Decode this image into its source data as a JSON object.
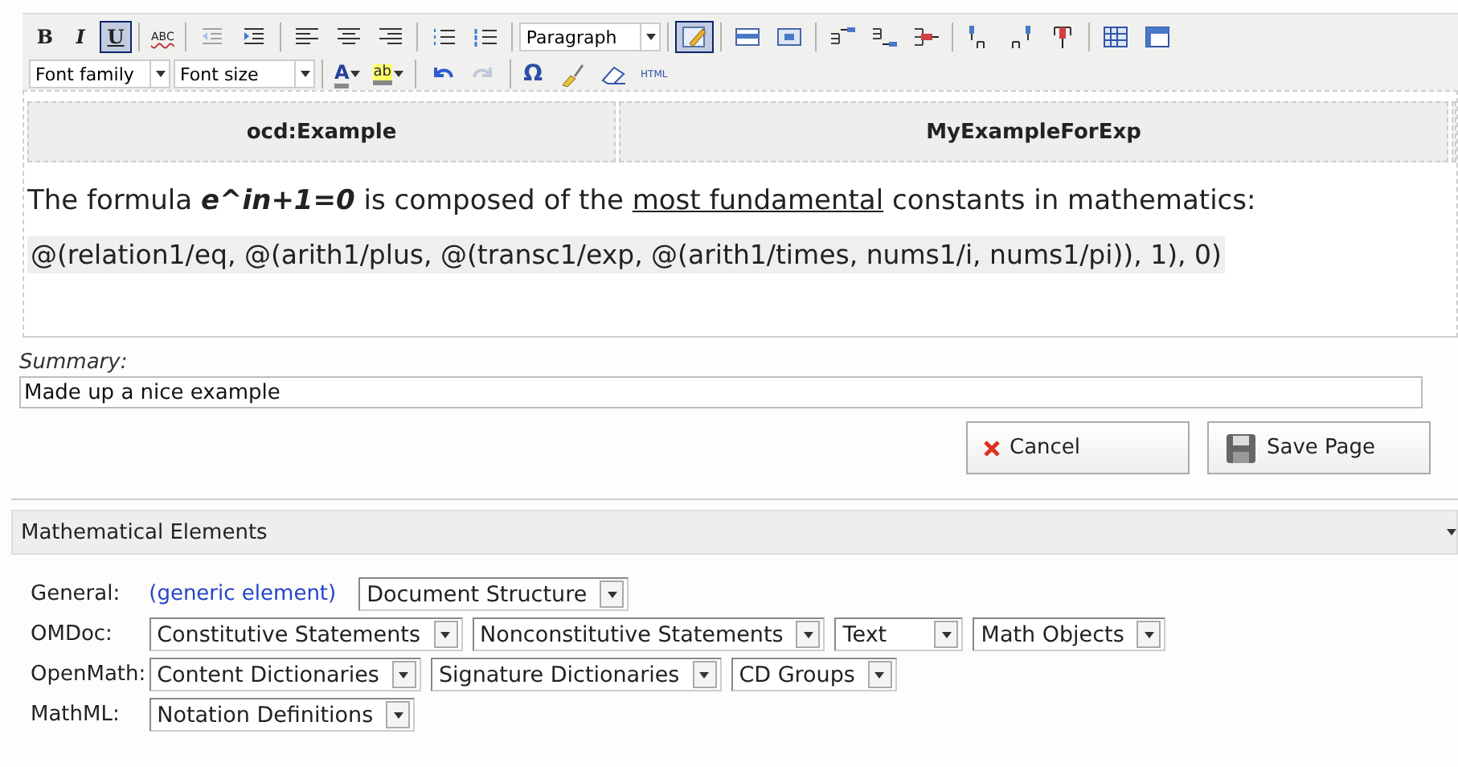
{
  "toolbar": {
    "row1": [
      {
        "kind": "text",
        "label": "B",
        "selected": false
      },
      {
        "kind": "text",
        "label": "I",
        "selected": false
      },
      {
        "kind": "text",
        "label": "U",
        "selected": true
      },
      {
        "kind": "separator"
      },
      {
        "kind": "text",
        "label": "ABC",
        "selected": false
      },
      {
        "kind": "separator"
      },
      {
        "kind": "icon",
        "selected": false,
        "disabled": true
      },
      {
        "kind": "icon",
        "selected": false,
        "disabled": false
      },
      {
        "kind": "separator"
      },
      {
        "kind": "icon",
        "selected": false,
        "disabled": false
      },
      {
        "kind": "icon",
        "selected": false,
        "disabled": false
      },
      {
        "kind": "icon",
        "selected": false,
        "disabled": false
      },
      {
        "kind": "separator"
      },
      {
        "kind": "icon",
        "selected": false,
        "disabled": false
      },
      {
        "kind": "icon",
        "selected": false,
        "disabled": false
      },
      {
        "kind": "separator"
      },
      {
        "kind": "select",
        "value": "Paragraph"
      },
      {
        "kind": "separator"
      },
      {
        "kind": "icon",
        "selected": true,
        "disabled": false
      },
      {
        "kind": "separator"
      },
      {
        "kind": "icon",
        "selected": false,
        "disabled": false
      },
      {
        "kind": "icon",
        "selected": false,
        "disabled": false
      },
      {
        "kind": "separator"
      },
      {
        "kind": "icon",
        "selected": false,
        "disabled": false
      },
      {
        "kind": "icon",
        "selected": false,
        "disabled": false
      },
      {
        "kind": "icon",
        "selected": false,
        "disabled": false
      },
      {
        "kind": "separator"
      },
      {
        "kind": "icon",
        "selected": false,
        "disabled": false
      },
      {
        "kind": "icon",
        "selected": false,
        "disabled": false
      },
      {
        "kind": "icon",
        "selected": false,
        "disabled": false
      },
      {
        "kind": "separator"
      },
      {
        "kind": "icon",
        "selected": false,
        "disabled": false
      },
      {
        "kind": "icon",
        "selected": false,
        "disabled": false
      }
    ],
    "row2": [
      {
        "kind": "select",
        "value": "Font family"
      },
      {
        "kind": "select",
        "value": "Font size"
      },
      {
        "kind": "separator"
      },
      {
        "kind": "text",
        "label": "A",
        "selected": false
      },
      {
        "kind": "text",
        "label": "ab",
        "selected": false
      },
      {
        "kind": "separator"
      },
      {
        "kind": "icon",
        "selected": false,
        "disabled": false
      },
      {
        "kind": "icon",
        "selected": false,
        "disabled": true
      },
      {
        "kind": "separator"
      },
      {
        "kind": "text",
        "label": "Ω",
        "selected": false
      },
      {
        "kind": "icon",
        "selected": false,
        "disabled": false
      },
      {
        "kind": "icon",
        "selected": false,
        "disabled": false
      },
      {
        "kind": "text",
        "label": "HTML",
        "selected": false
      }
    ]
  },
  "editor": {
    "table_headers": [
      "ocd:Example",
      "MyExampleForExp"
    ],
    "paragraph": [
      {
        "kind": "plain",
        "text": "The formula "
      },
      {
        "kind": "formula",
        "text": "e^in+1=0"
      },
      {
        "kind": "plain",
        "text": " is composed of the "
      },
      {
        "kind": "underline",
        "text": "most fundamental"
      },
      {
        "kind": "plain",
        "text": " constants in mathematics:"
      }
    ],
    "formula_line": "@(relation1/eq, @(arith1/plus, @(transc1/exp, @(arith1/times, nums1/i, nums1/pi)), 1), 0)"
  },
  "summary": {
    "label": "Summary:",
    "value": "Made up a nice example"
  },
  "buttons": [
    {
      "kind": "cancel",
      "label": "Cancel"
    },
    {
      "kind": "save",
      "label": "Save Page"
    }
  ],
  "panel": {
    "title": "Mathematical Elements",
    "rows": [
      {
        "label": "General:",
        "items": [
          {
            "kind": "link",
            "text": "(generic element)"
          },
          {
            "kind": "select",
            "text": "Document Structure"
          }
        ]
      },
      {
        "label": "OMDoc:",
        "items": [
          {
            "kind": "select",
            "text": "Constitutive Statements"
          },
          {
            "kind": "select",
            "text": "Nonconstitutive Statements"
          },
          {
            "kind": "select",
            "text": "Text"
          },
          {
            "kind": "select",
            "text": "Math Objects"
          }
        ]
      },
      {
        "label": "OpenMath:",
        "items": [
          {
            "kind": "select",
            "text": "Content Dictionaries"
          },
          {
            "kind": "select",
            "text": "Signature Dictionaries"
          },
          {
            "kind": "select",
            "text": "CD Groups"
          }
        ]
      },
      {
        "label": "MathML:",
        "items": [
          {
            "kind": "select",
            "text": "Notation Definitions"
          }
        ]
      }
    ]
  }
}
